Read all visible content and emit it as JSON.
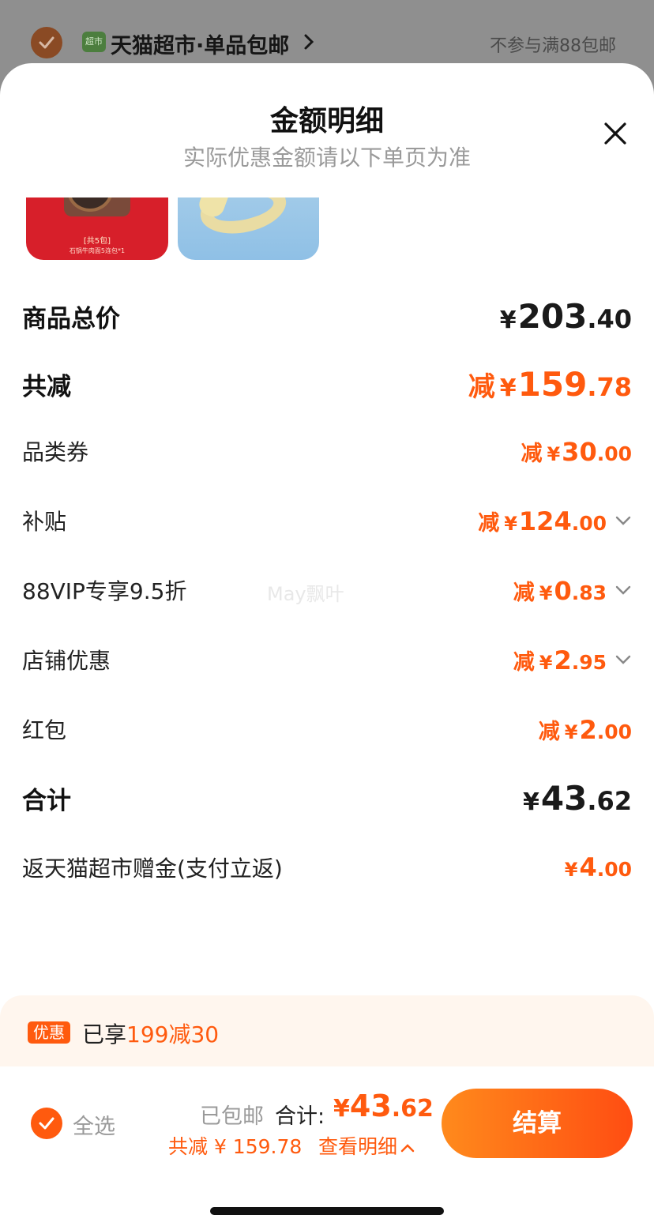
{
  "background": {
    "store_name": "天猫超市·单品包邮",
    "logo_text": "超市",
    "note": "不参与满88包邮"
  },
  "sheet": {
    "title": "金额明细",
    "subtitle": "实际优惠金额请以下单页为准",
    "thumb_tag": "[共5包]",
    "thumb_caption": "石锅牛肉面5连包*1"
  },
  "rows": [
    {
      "label": "商品总价",
      "prefix": "",
      "yen": "¥",
      "int": "203",
      "dec": ".40",
      "style": "bold-dark"
    },
    {
      "label": "共减",
      "prefix": "减",
      "yen": "¥",
      "int": "159",
      "dec": ".78",
      "style": "bold-orange"
    },
    {
      "label": "品类券",
      "prefix": "减",
      "yen": "¥",
      "int": "30",
      "dec": ".00",
      "style": "orange"
    },
    {
      "label": "补贴",
      "prefix": "减",
      "yen": "¥",
      "int": "124",
      "dec": ".00",
      "style": "orange"
    },
    {
      "label": "88VIP专享9.5折",
      "prefix": "减",
      "yen": "¥",
      "int": "0",
      "dec": ".83",
      "style": "orange"
    },
    {
      "label": "店铺优惠",
      "prefix": "减",
      "yen": "¥",
      "int": "2",
      "dec": ".95",
      "style": "orange"
    },
    {
      "label": "红包",
      "prefix": "减",
      "yen": "¥",
      "int": "2",
      "dec": ".00",
      "style": "orange"
    },
    {
      "label": "合计",
      "prefix": "",
      "yen": "¥",
      "int": "43",
      "dec": ".62",
      "style": "bold-dark"
    },
    {
      "label": "返天猫超市赠金(支付立返)",
      "prefix": "",
      "yen": "¥",
      "int": "4",
      "dec": ".00",
      "style": "orange"
    }
  ],
  "watermark": "May飘叶",
  "promo": {
    "badge": "优惠",
    "text_prefix": "已享",
    "text_highlight": "199减30"
  },
  "footer": {
    "select_all": "全选",
    "shipping": "已包邮",
    "total_label": "合计:",
    "total_yen": "¥",
    "total_int": "43",
    "total_dec": ".62",
    "saved": "共减 ¥ 159.78",
    "detail_link": "查看明细",
    "checkout": "结算"
  },
  "colors": {
    "accent": "#ff5a0e",
    "muted": "#9a9a9a"
  }
}
